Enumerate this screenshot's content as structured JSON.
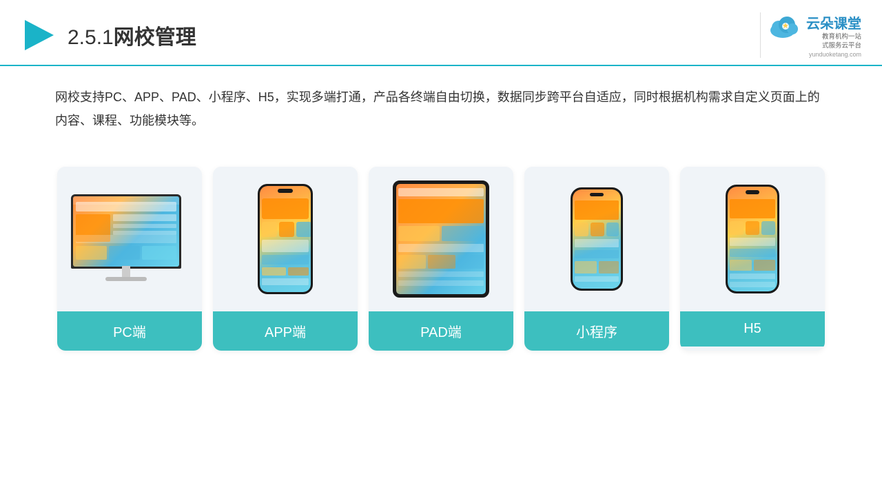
{
  "header": {
    "section_number": "2.5.1",
    "title": "网校管理",
    "brand_name": "云朵课堂",
    "brand_tagline": "教育机构一站\n式服务云平台",
    "brand_url": "yunduoketang.com"
  },
  "description": {
    "text": "网校支持PC、APP、PAD、小程序、H5，实现多端打通，产品各终端自由切换，数据同步跨平台自适应，同时根据机构需求自定义页面上的内容、课程、功能模块等。"
  },
  "cards": [
    {
      "id": "pc",
      "label": "PC端"
    },
    {
      "id": "app",
      "label": "APP端"
    },
    {
      "id": "pad",
      "label": "PAD端"
    },
    {
      "id": "miniprogram",
      "label": "小程序"
    },
    {
      "id": "h5",
      "label": "H5"
    }
  ],
  "colors": {
    "accent": "#3dbfbf",
    "header_line": "#1ab3c8",
    "brand_blue": "#2a8fc5",
    "card_bg": "#eef2f7"
  }
}
